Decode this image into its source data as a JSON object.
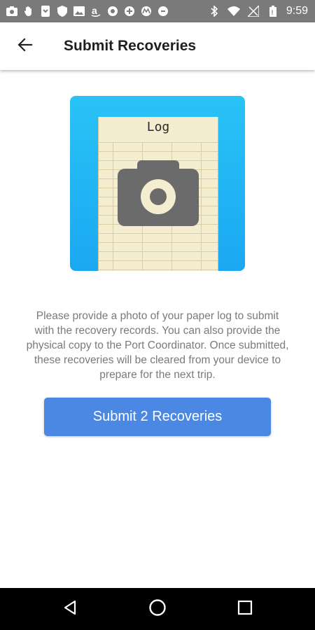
{
  "status_bar": {
    "time": "9:59",
    "left_icons": [
      "camera-icon",
      "hand-icon",
      "phone-sync-icon",
      "shield-icon",
      "image-icon",
      "amazon-icon",
      "circle-icon",
      "plus-circle-icon",
      "motorola-icon",
      "circle-icon"
    ],
    "right_icons": [
      "bluetooth-icon",
      "wifi-icon",
      "no-signal-icon",
      "battery-icon"
    ]
  },
  "app_bar": {
    "back_icon": "arrow-left-icon",
    "title": "Submit Recoveries"
  },
  "illustration": {
    "paper_title": "Log",
    "icon": "camera-icon",
    "colors": {
      "background": "#1ba8f2",
      "paper": "#f4edcf",
      "camera": "#6b6b6b"
    }
  },
  "main": {
    "description": "Please provide a photo of your paper log to submit with the recovery records. You can also provide the physical copy to the Port Coordinator. Once submitted, these recoveries will be cleared from your device to prepare for the next trip.",
    "submit_label": "Submit 2 Recoveries",
    "submit_color": "#4a88e3"
  },
  "nav_bar": {
    "icons": [
      "back-triangle-icon",
      "home-circle-icon",
      "recents-square-icon"
    ]
  }
}
